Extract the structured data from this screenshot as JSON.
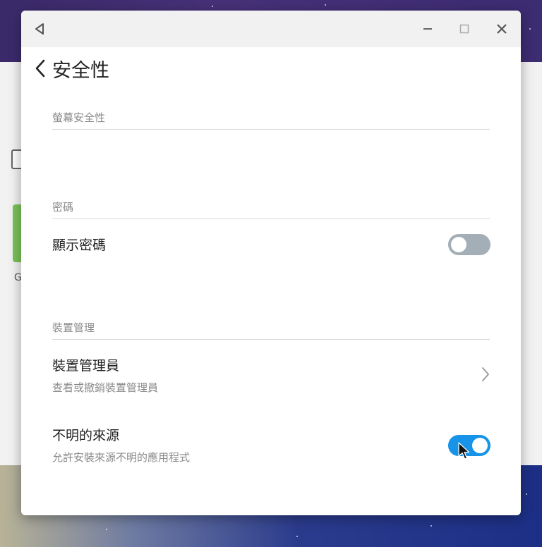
{
  "window": {
    "title_bar": {
      "back_icon": "triangle-left-icon",
      "minimize_icon": "minimize-icon",
      "maximize_icon": "maximize-icon",
      "close_icon": "close-icon"
    },
    "page_title": "安全性",
    "sections": {
      "screen_security": {
        "header": "螢幕安全性"
      },
      "password": {
        "header": "密碼",
        "show_password": {
          "label": "顯示密碼",
          "enabled": false
        }
      },
      "device_management": {
        "header": "裝置管理",
        "device_admins": {
          "title": "裝置管理員",
          "subtitle": "查看或撤銷裝置管理員"
        },
        "unknown_sources": {
          "title": "不明的來源",
          "subtitle": "允許安裝來源不明的應用程式",
          "enabled": true
        }
      }
    }
  },
  "background": {
    "partial_letter": "G"
  },
  "colors": {
    "toggle_on": "#1793e8",
    "toggle_off": "#a3aeb7",
    "section_text": "#8a8a8a"
  }
}
